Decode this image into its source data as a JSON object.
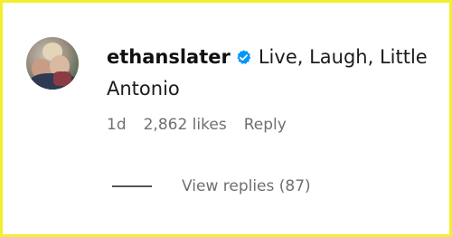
{
  "comment": {
    "username": "ethanslater",
    "text_part1": "Live, Laugh, Little",
    "text_part2": "Antonio",
    "verified_icon": "verified-badge-icon",
    "verified_color": "#0095f6"
  },
  "meta": {
    "age": "1d",
    "likes": "2,862 likes",
    "reply_label": "Reply"
  },
  "replies": {
    "label": "View replies (87)"
  },
  "frame_color": "#f2ef2c"
}
